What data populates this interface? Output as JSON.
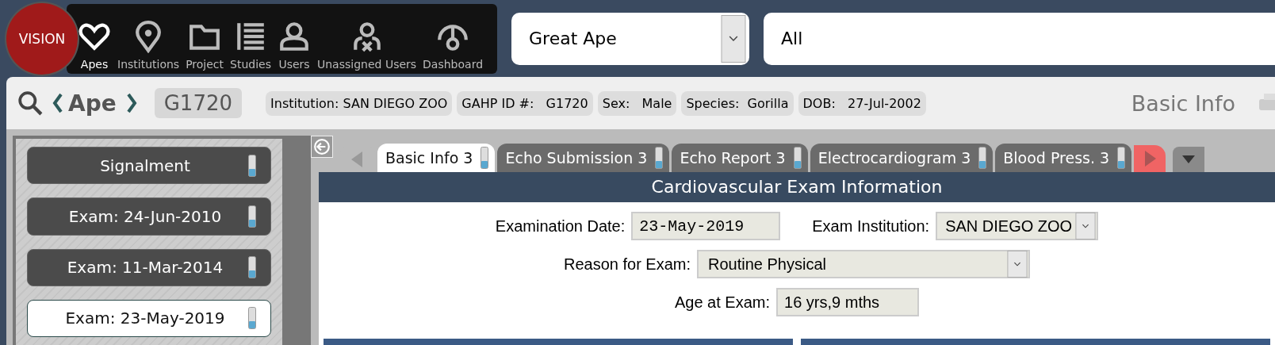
{
  "logo": "VISION",
  "nav": [
    {
      "label": "Apes",
      "kind": "heart",
      "selected": true
    },
    {
      "label": "Institutions",
      "kind": "pin",
      "selected": false
    },
    {
      "label": "Project",
      "kind": "folder",
      "selected": false
    },
    {
      "label": "Studies",
      "kind": "list",
      "selected": false
    },
    {
      "label": "Users",
      "kind": "user",
      "selected": false
    },
    {
      "label": "Unassigned Users",
      "kind": "userx",
      "selected": false
    },
    {
      "label": "Dashboard",
      "kind": "gauge",
      "selected": false
    }
  ],
  "filters": [
    {
      "value": "Great Ape",
      "kind": "select"
    },
    {
      "value": "All",
      "kind": "text"
    }
  ],
  "record": {
    "type": "Ape",
    "id": "G1720",
    "chips": [
      "Institution: SAN DIEGO ZOO",
      "GAHP ID #:   G1720",
      "Sex:   Male",
      "Species:  Gorilla",
      "DOB:   27-Jul-2002"
    ],
    "section": "Basic Info"
  },
  "sidebar": [
    {
      "label": "Signalment",
      "selected": false
    },
    {
      "label": "Exam: 24-Jun-2010",
      "selected": false
    },
    {
      "label": "Exam: 11-Mar-2014",
      "selected": false
    },
    {
      "label": "Exam: 23-May-2019",
      "selected": true
    }
  ],
  "tabs": [
    {
      "label": "Basic Info 3",
      "selected": true
    },
    {
      "label": "Echo Submission 3",
      "selected": false
    },
    {
      "label": "Echo Report 3",
      "selected": false
    },
    {
      "label": "Electrocardiogram 3",
      "selected": false
    },
    {
      "label": "Blood Press. 3",
      "selected": false
    }
  ],
  "form": {
    "title": "Cardiovascular Exam Information",
    "rows": [
      [
        {
          "label": "Examination Date:",
          "value": "23-May-2019",
          "kind": "date"
        },
        {
          "label": "Exam Institution:",
          "value": "SAN DIEGO ZOO",
          "kind": "select"
        }
      ],
      [
        {
          "label": "Reason for Exam:",
          "value": "Routine Physical",
          "kind": "select"
        }
      ],
      [
        {
          "label": "Age at Exam:",
          "value": "16 yrs,9 mths",
          "kind": "text"
        }
      ]
    ]
  }
}
